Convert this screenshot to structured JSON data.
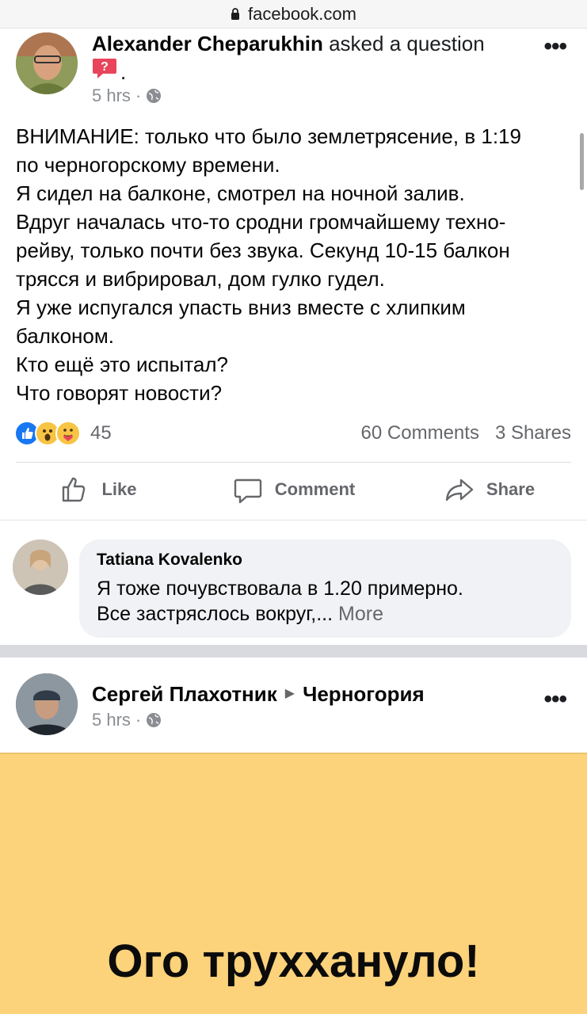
{
  "browser": {
    "url": "facebook.com"
  },
  "post1": {
    "author": "Alexander Cheparukhin",
    "action": "asked a question",
    "punct": ".",
    "time": "5 hrs",
    "meta_sep": "·",
    "text_lines": [
      "ВНИМАНИЕ: только что было землетрясение, в 1:19",
      "по черногорскому времени.",
      "Я сидел на балконе, смотрел на ночной залив.",
      "Вдруг началась что-то сродни громчайшему техно-",
      "рейву, только почти без звука. Секунд 10-15 балкон",
      "трясся и вибрировал, дом гулко гудел.",
      "Я уже испугался упасть вниз вместе с хлипким",
      "балконом.",
      "Кто ещё это испытал?",
      "Что говорят новости?"
    ],
    "reaction_count": "45",
    "comments": "60 Comments",
    "shares": "3 Shares",
    "actions": {
      "like": "Like",
      "comment": "Comment",
      "share": "Share"
    }
  },
  "comment": {
    "author": "Tatiana Kovalenko",
    "line1": "Я тоже почувствовала в 1.20 примерно.",
    "line2": "Все застряслось вокруг,...",
    "more": "More"
  },
  "post2": {
    "author": "Сергей Плахотник",
    "group": "Черногория",
    "time": "5 hrs",
    "meta_sep": "·",
    "card_text": "Ого труххануло!"
  },
  "colors": {
    "accent": "#1877f2",
    "card_bg": "#fcd27a",
    "muted": "#65676b"
  }
}
